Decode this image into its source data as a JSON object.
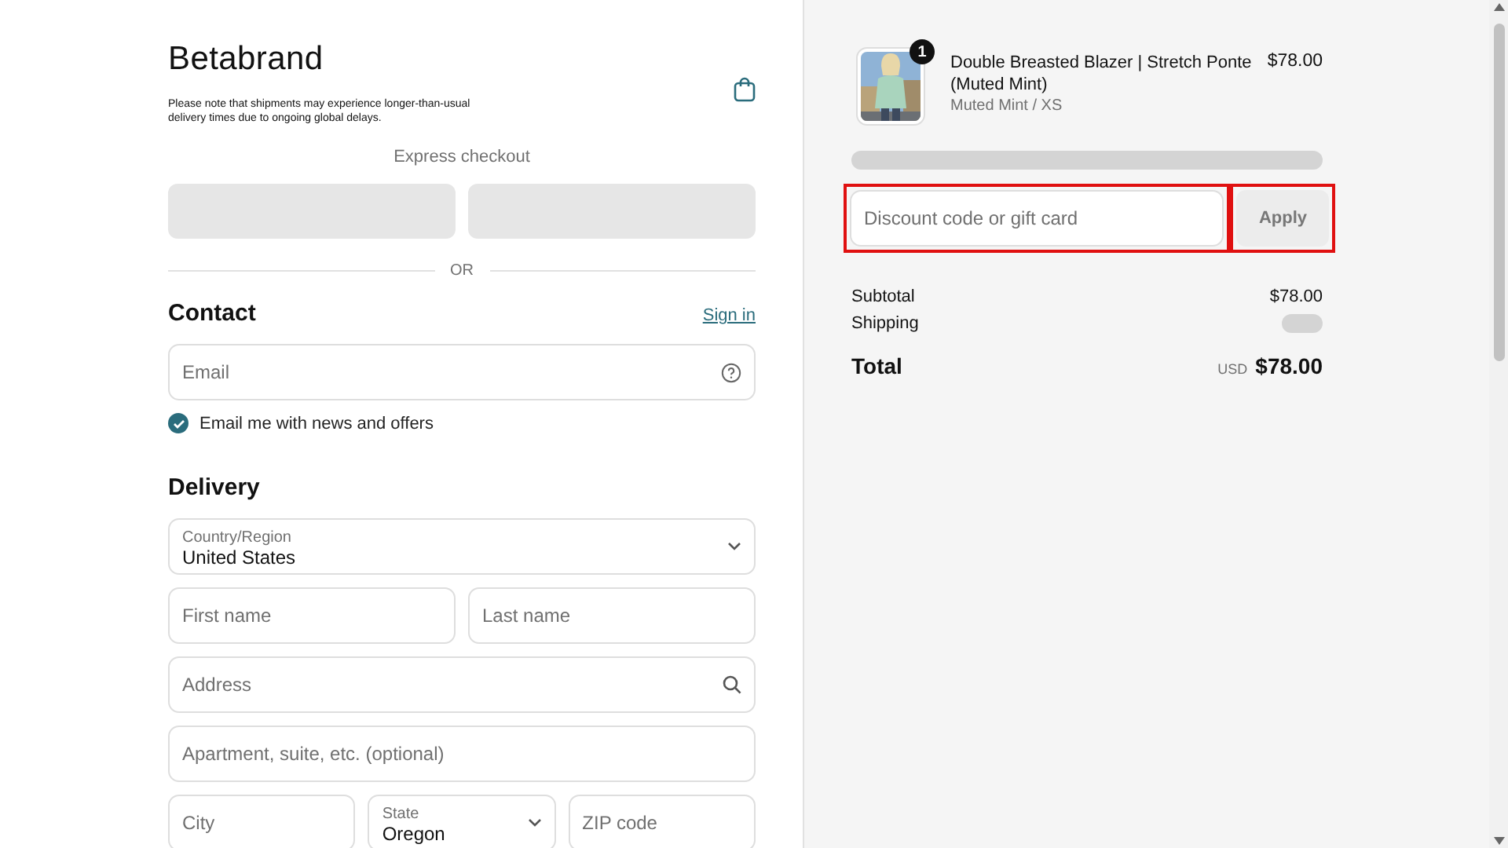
{
  "header": {
    "logo": "Betabrand",
    "notice": "Please note that shipments may experience longer-than-usual delivery times due to ongoing global delays."
  },
  "express_checkout": {
    "label": "Express checkout",
    "separator": "OR"
  },
  "contact": {
    "heading": "Contact",
    "sign_in": "Sign in",
    "email": {
      "placeholder": "Email"
    },
    "newsletter": {
      "label": "Email me with news and offers",
      "checked": true
    }
  },
  "delivery": {
    "heading": "Delivery",
    "rows": [
      [
        {
          "kind": "select",
          "label": "Country/Region",
          "value": "United States"
        }
      ],
      [
        {
          "kind": "text",
          "placeholder": "First name"
        },
        {
          "kind": "text",
          "placeholder": "Last name"
        }
      ],
      [
        {
          "kind": "search",
          "placeholder": "Address"
        }
      ],
      [
        {
          "kind": "text",
          "placeholder": "Apartment, suite, etc. (optional)"
        }
      ],
      [
        {
          "kind": "text",
          "placeholder": "City"
        },
        {
          "kind": "select",
          "label": "State",
          "value": "Oregon"
        },
        {
          "kind": "text",
          "placeholder": "ZIP code"
        }
      ]
    ]
  },
  "order": {
    "items": [
      {
        "name": "Double Breasted Blazer | Stretch Ponte (Muted Mint)",
        "variant": "Muted Mint / XS",
        "price": "$78.00",
        "quantity": "1"
      }
    ],
    "discount": {
      "placeholder": "Discount code or gift card"
    },
    "apply": "Apply",
    "subtotal": {
      "label": "Subtotal",
      "value": "$78.00"
    },
    "shipping": {
      "label": "Shipping"
    },
    "total": {
      "label": "Total",
      "currency": "USD",
      "value": "$78.00"
    }
  }
}
